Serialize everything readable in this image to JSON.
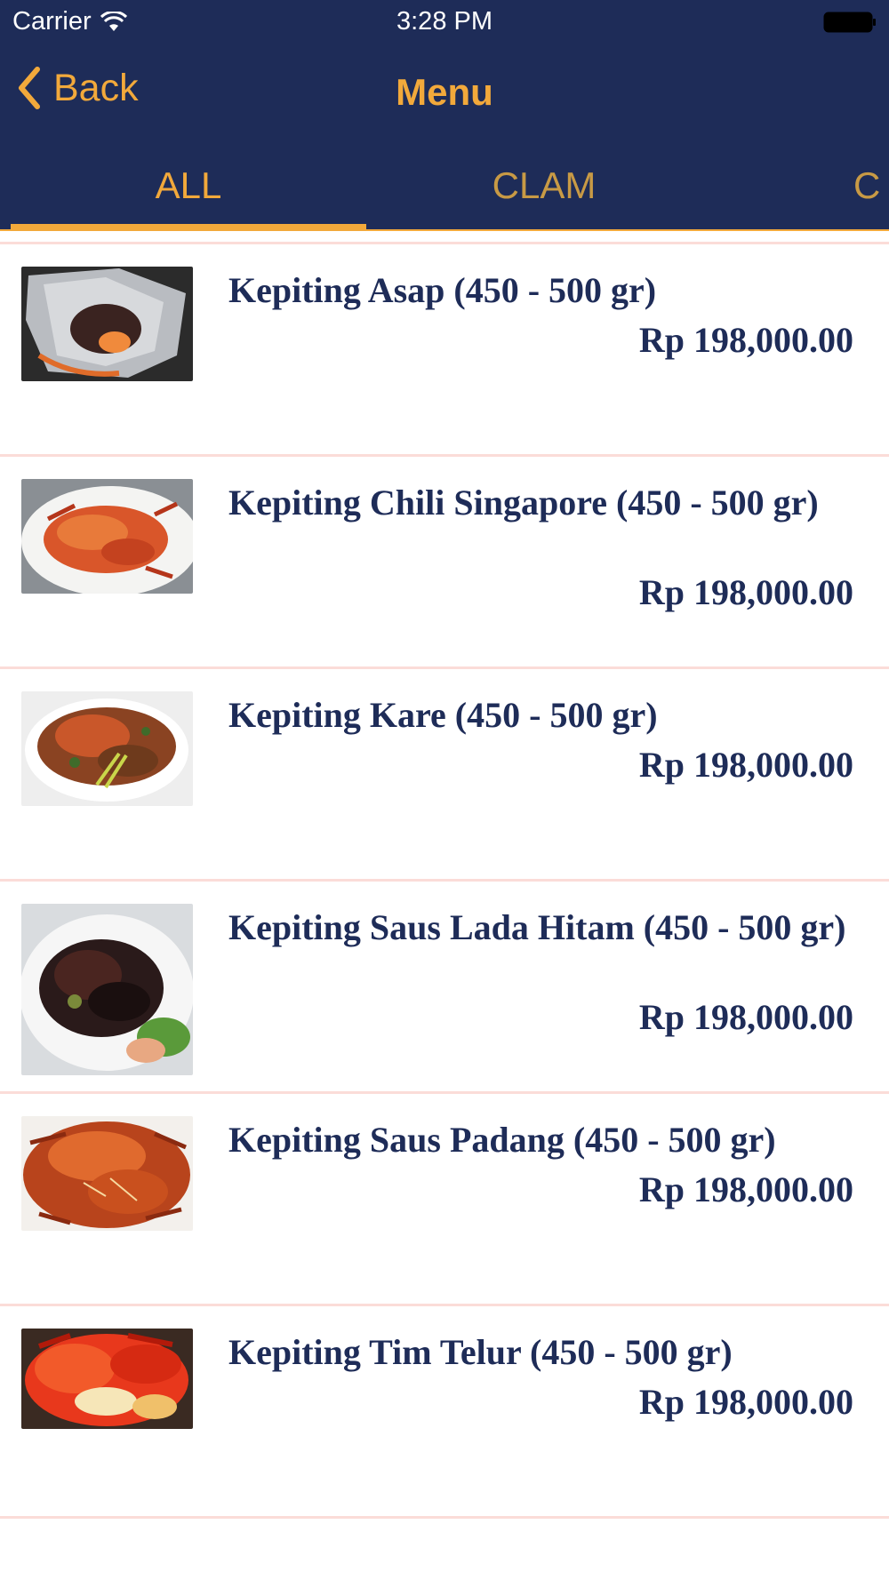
{
  "status_bar": {
    "carrier": "Carrier",
    "time": "3:28 PM"
  },
  "nav": {
    "back_label": "Back",
    "title": "Menu"
  },
  "tabs": [
    {
      "label": "ALL",
      "selected": true
    },
    {
      "label": "CLAM",
      "selected": false
    },
    {
      "label": "C",
      "selected": false
    }
  ],
  "colors": {
    "header_bg": "#1e2c58",
    "accent": "#f2a93b",
    "divider": "#fbdcd8",
    "text": "#1e2c58"
  },
  "menu_items": [
    {
      "name": "Kepiting Asap (450 - 500 gr)",
      "price": "Rp 198,000.00",
      "image": "smoked-crab-in-foil"
    },
    {
      "name": "Kepiting Chili Singapore (450 - 500 gr)",
      "price": "Rp 198,000.00",
      "image": "chili-crab"
    },
    {
      "name": "Kepiting Kare (450 - 500 gr)",
      "price": "Rp 198,000.00",
      "image": "curry-crab"
    },
    {
      "name": "Kepiting Saus Lada Hitam (450 - 500 gr)",
      "price": "Rp 198,000.00",
      "image": "black-pepper-crab"
    },
    {
      "name": "Kepiting Saus Padang (450 - 500 gr)",
      "price": "Rp 198,000.00",
      "image": "padang-sauce-crab"
    },
    {
      "name": "Kepiting Tim Telur (450 - 500 gr)",
      "price": "Rp 198,000.00",
      "image": "steamed-egg-crab"
    }
  ]
}
